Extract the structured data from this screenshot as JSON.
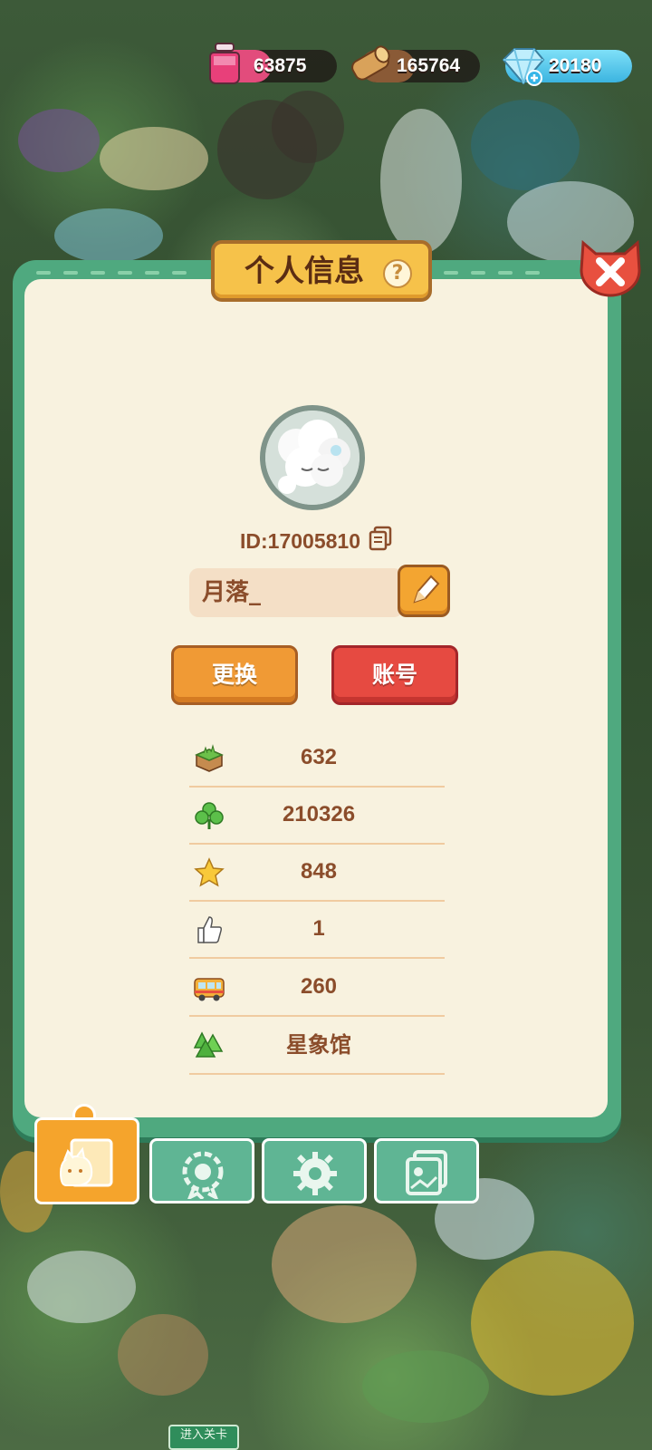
{
  "resources": {
    "ink": {
      "icon": "ink-bottle-icon",
      "value": "63875",
      "color": "#e24c7c"
    },
    "wood": {
      "icon": "wood-log-icon",
      "value": "165764",
      "color": "#c98a4a"
    },
    "gem": {
      "icon": "crystal-plus-icon",
      "value": "20180",
      "color": "#4fc3e8"
    }
  },
  "panel": {
    "title": "个人信息",
    "help_icon": "question-icon",
    "close_icon": "close-icon"
  },
  "profile": {
    "avatar": "cloud-sheep-avatar",
    "id_text": "ID:17005810",
    "copy_icon": "copy-icon",
    "name": "月落_",
    "edit_icon": "pencil-icon"
  },
  "buttons": {
    "change": "更换",
    "account": "账号"
  },
  "stats": [
    {
      "icon": "grass-block-icon",
      "value": "632"
    },
    {
      "icon": "clover-icon",
      "value": "210326"
    },
    {
      "icon": "star-icon",
      "value": "848"
    },
    {
      "icon": "thumbs-up-icon",
      "value": "1"
    },
    {
      "icon": "bus-icon",
      "value": "260"
    },
    {
      "icon": "tree-icon",
      "value": "星象馆"
    }
  ],
  "tabs": [
    {
      "icon": "cat-card-icon",
      "selected": true
    },
    {
      "icon": "flower-badge-icon",
      "selected": false
    },
    {
      "icon": "gear-icon",
      "selected": false
    },
    {
      "icon": "photo-album-icon",
      "selected": false
    }
  ],
  "scene": {
    "enter_level": "进入关卡"
  },
  "colors": {
    "panel_frame": "#4fa97f",
    "panel_body": "#f8f2df",
    "text_brown": "#8b4d2b",
    "title_plate": "#f6c24a",
    "close_red": "#e8503f"
  }
}
